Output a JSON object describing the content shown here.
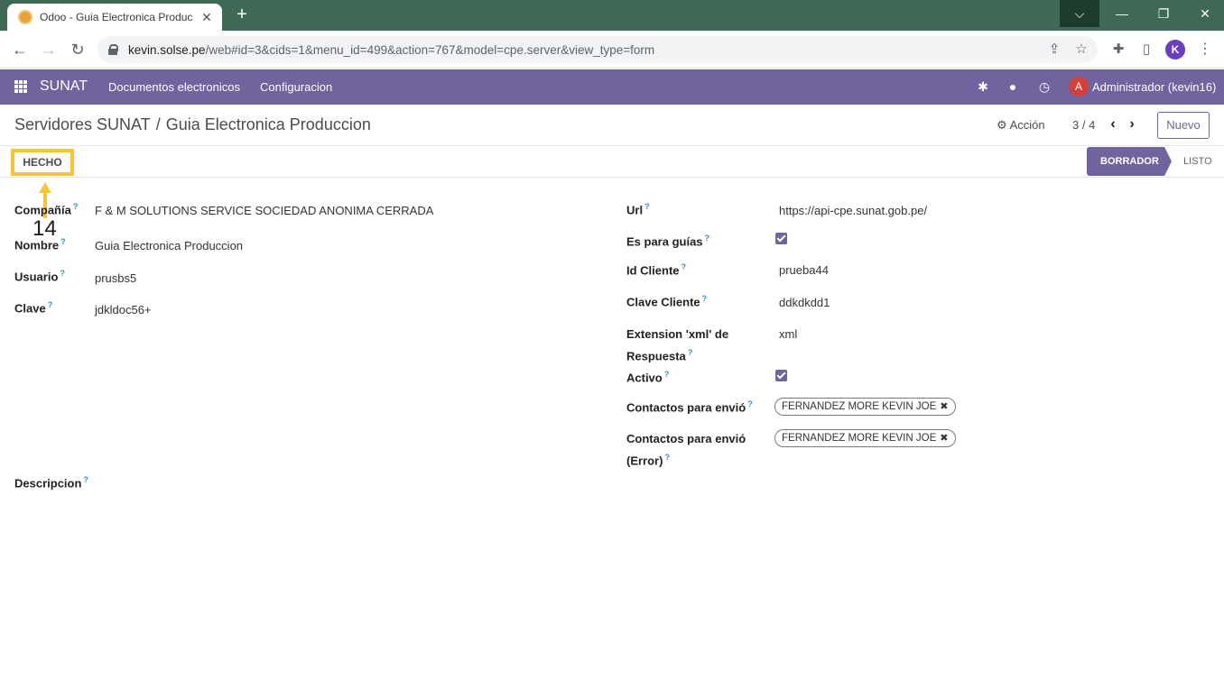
{
  "browser": {
    "tab_title": "Odoo - Guia Electronica Produc",
    "tab_close": "✕",
    "new_tab": "+",
    "url_host": "kevin.solse.pe",
    "url_rest": "/web#id=3&cids=1&menu_id=499&action=767&model=cpe.server&view_type=form",
    "profile_initial": "K",
    "controls": {
      "dropdown": "⌵",
      "minimize": "—",
      "maximize": "❐",
      "close": "✕"
    },
    "nav": {
      "back": "←",
      "forward": "→",
      "reload": "↻"
    }
  },
  "navbar": {
    "brand": "SUNAT",
    "menus": [
      "Documentos electronicos",
      "Configuracion"
    ],
    "user_initial": "A",
    "user_name": "Administrador (kevin16)"
  },
  "control_panel": {
    "breadcrumb_parent": "Servidores SUNAT",
    "breadcrumb_separator": "/",
    "breadcrumb_current": "Guia Electronica Produccion",
    "action_label": "Acción",
    "pager": "3 / 4",
    "new_button": "Nuevo"
  },
  "status": {
    "done_button": "HECHO",
    "stages": [
      "BORRADOR",
      "LISTO"
    ],
    "active_stage": "BORRADOR"
  },
  "annotation": {
    "step": "14",
    "color": "#f6c53b"
  },
  "form": {
    "help_mark": "?",
    "left": [
      {
        "label": "Compañía",
        "value": "F & M SOLUTIONS SERVICE SOCIEDAD ANONIMA CERRADA"
      },
      {
        "label": "Nombre",
        "value": "Guia Electronica Produccion"
      },
      {
        "label": "Usuario",
        "value": "prusbs5"
      },
      {
        "label": "Clave",
        "value": "jdkldoc56+"
      }
    ],
    "description_label": "Descripcion",
    "right": {
      "url_label": "Url",
      "url_value": "https://api-cpe.sunat.gob.pe/",
      "guias_label": "Es para guías",
      "guias_checked": true,
      "id_cliente_label": "Id Cliente",
      "id_cliente_value": "prueba44",
      "clave_cliente_label": "Clave Cliente",
      "clave_cliente_value": "ddkdkdd1",
      "extension_label_line1": "Extension 'xml' de",
      "extension_label_line2": "Respuesta",
      "extension_value": "xml",
      "activo_label": "Activo",
      "activo_checked": true,
      "contactos_label": "Contactos para envió",
      "contactos_tag": "FERNANDEZ MORE KEVIN JOE",
      "contactos_error_label_line1": "Contactos para envió",
      "contactos_error_label_line2": "(Error)",
      "contactos_error_tag": "FERNANDEZ MORE KEVIN JOE"
    }
  },
  "colors": {
    "navbar": "#71639e",
    "tab_strip": "#3e6a55",
    "highlight": "#f6c53b"
  }
}
